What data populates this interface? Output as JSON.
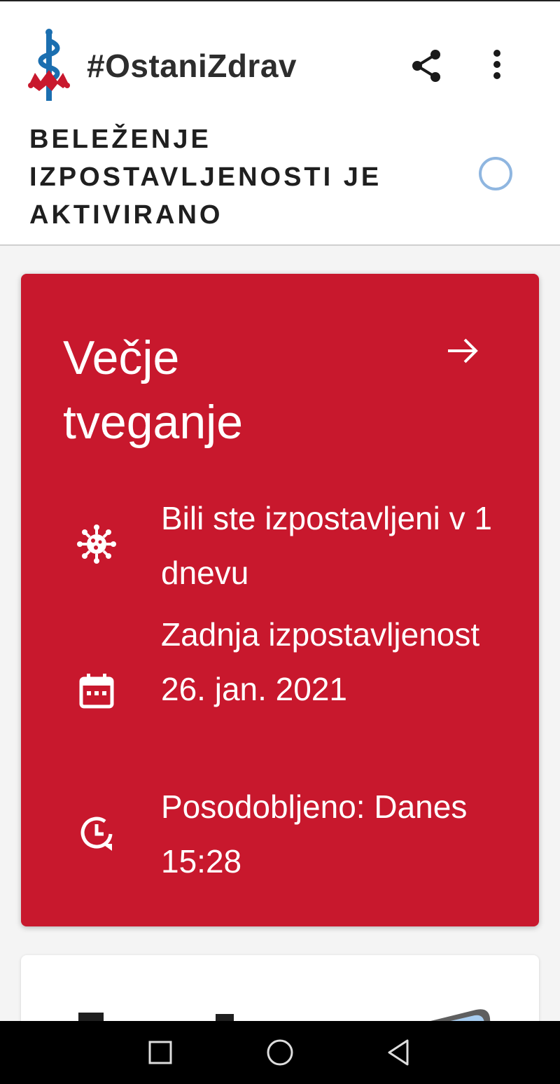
{
  "header": {
    "app_title": "#OstaniZdrav",
    "logo_icon": "aesculapius-logo-icon",
    "share_icon": "share-icon",
    "more_icon": "more-vert-icon"
  },
  "exposure_status": {
    "text": "BELEŽENJE IZPOSTAVLJENOSTI JE AKTIVIRANO",
    "indicator_color": "#8fb6e0"
  },
  "risk_card": {
    "title": "Večje tveganje",
    "background_color": "#c8182d",
    "arrow_icon": "arrow-right-icon",
    "rows": [
      {
        "icon": "virus-icon",
        "text": "Bili ste izpostavljeni v 1 dnevu"
      },
      {
        "icon": "calendar-icon",
        "text": "Zadnja izpostavljenost 26. jan. 2021"
      },
      {
        "icon": "clock-refresh-icon",
        "text": "Posodobljeno: Danes 15:28"
      }
    ]
  },
  "navbar": {
    "recents_icon": "square-recents-icon",
    "home_icon": "circle-home-icon",
    "back_icon": "triangle-back-icon"
  }
}
